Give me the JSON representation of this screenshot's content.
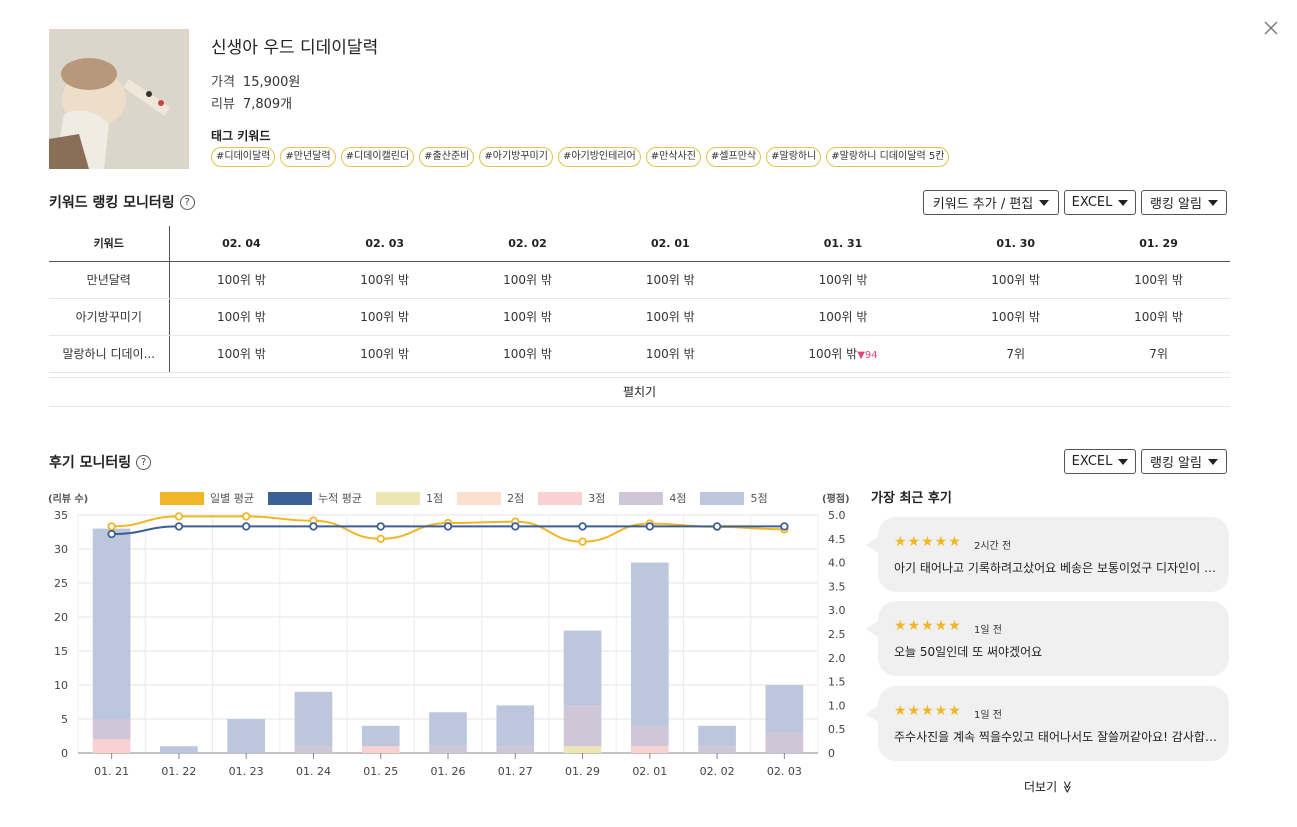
{
  "product": {
    "title": "신생아 우드 디데이달력",
    "price_label": "가격",
    "price": "15,900원",
    "review_label": "리뷰",
    "review_count": "7,809개",
    "tag_heading": "태그 키워드",
    "tags": [
      "#디데이달력",
      "#만년달력",
      "#디데이캘린더",
      "#출산준비",
      "#아기방꾸미기",
      "#아기방인테리어",
      "#만삭사진",
      "#셀프만삭",
      "#말랑하니",
      "#말랑하니 디데이달력 5칸"
    ]
  },
  "ranking": {
    "title": "키워드 랭킹 모니터링",
    "help": "?",
    "buttons": {
      "edit": "키워드 추가 / 편집",
      "excel": "EXCEL",
      "alert": "랭킹 알림"
    },
    "keyword_header": "키워드",
    "dates": [
      "02. 04",
      "02. 03",
      "02. 02",
      "02. 01",
      "01. 31",
      "01. 30",
      "01. 29"
    ],
    "rows": [
      {
        "keyword": "만년달력",
        "cells": [
          "100위 밖",
          "100위 밖",
          "100위 밖",
          "100위 밖",
          "100위 밖",
          "100위 밖",
          "100위 밖"
        ],
        "change": ""
      },
      {
        "keyword": "아기방꾸미기",
        "cells": [
          "100위 밖",
          "100위 밖",
          "100위 밖",
          "100위 밖",
          "100위 밖",
          "100위 밖",
          "100위 밖"
        ],
        "change": ""
      },
      {
        "keyword": "말랑하니 디데이...",
        "cells": [
          "100위 밖",
          "100위 밖",
          "100위 밖",
          "100위 밖",
          "100위 밖",
          "7위",
          "7위"
        ],
        "change": "▼94"
      }
    ],
    "expand": "펼치기"
  },
  "reviews": {
    "title": "후기 모니터링",
    "help": "?",
    "buttons": {
      "excel": "EXCEL",
      "alert": "랭킹 알림"
    },
    "recent_title": "가장 최근 후기",
    "recent": [
      {
        "stars": "★★★★★",
        "ago": "2시간 전",
        "text": "아기 태어나고 기록하려고샀어요 베송은 보통이었구 디자인이 예뻐요"
      },
      {
        "stars": "★★★★★",
        "ago": "1일 전",
        "text": "오늘 50일인데 또 써야겠어요"
      },
      {
        "stars": "★★★★★",
        "ago": "1일 전",
        "text": "주수사진을 계속 찍을수있고 태어나서도 잘쓸꺼같아요! 감사합니다"
      }
    ],
    "more": "더보기"
  },
  "chart_data": {
    "type": "bar",
    "left_axis_label": "(리뷰 수)",
    "right_axis_label": "(평점)",
    "categories": [
      "01. 21",
      "01. 22",
      "01. 23",
      "01. 24",
      "01. 25",
      "01. 26",
      "01. 27",
      "01. 29",
      "02. 01",
      "02. 02",
      "02. 03"
    ],
    "ylim": [
      0,
      35
    ],
    "y2lim": [
      0,
      5
    ],
    "yticks": [
      "35",
      "30",
      "25",
      "20",
      "15",
      "10",
      "5",
      "0"
    ],
    "y2ticks": [
      "5.0",
      "4.5",
      "4.0",
      "3.5",
      "3.0",
      "2.5",
      "2.0",
      "1.5",
      "1.0",
      "0.5",
      "0"
    ],
    "stacked_series": [
      {
        "name": "1점",
        "color": "#ede6b4",
        "values": [
          0,
          0,
          0,
          0,
          0,
          0,
          0,
          1,
          0,
          0,
          0
        ]
      },
      {
        "name": "2점",
        "color": "#fbe0d0",
        "values": [
          0,
          0,
          0,
          0,
          0,
          0,
          0,
          0,
          0,
          0,
          0
        ]
      },
      {
        "name": "3점",
        "color": "#f9d1d1",
        "values": [
          2,
          0,
          0,
          0,
          1,
          0,
          0,
          0,
          1,
          0,
          0
        ]
      },
      {
        "name": "4점",
        "color": "#cfc6d8",
        "values": [
          3,
          0,
          0,
          1,
          0,
          1,
          1,
          6,
          3,
          1,
          3
        ]
      },
      {
        "name": "5점",
        "color": "#bcc6dc",
        "values": [
          28,
          1,
          5,
          8,
          3,
          5,
          6,
          11,
          24,
          3,
          7
        ]
      }
    ],
    "line_series": [
      {
        "name": "일별 평균",
        "color": "#f0b625",
        "values": [
          4.76,
          4.97,
          4.97,
          4.88,
          4.5,
          4.83,
          4.86,
          4.44,
          4.82,
          4.75,
          4.7
        ]
      },
      {
        "name": "누적 평균",
        "color": "#3b5f96",
        "values": [
          4.6,
          4.76,
          4.76,
          4.76,
          4.76,
          4.76,
          4.76,
          4.76,
          4.76,
          4.76,
          4.76
        ]
      }
    ],
    "legend": [
      "일별 평균",
      "누적 평균",
      "1점",
      "2점",
      "3점",
      "4점",
      "5점"
    ]
  },
  "colors": {
    "accent": "#f0b625",
    "navy": "#3b5f96",
    "down": "#e0457b"
  }
}
